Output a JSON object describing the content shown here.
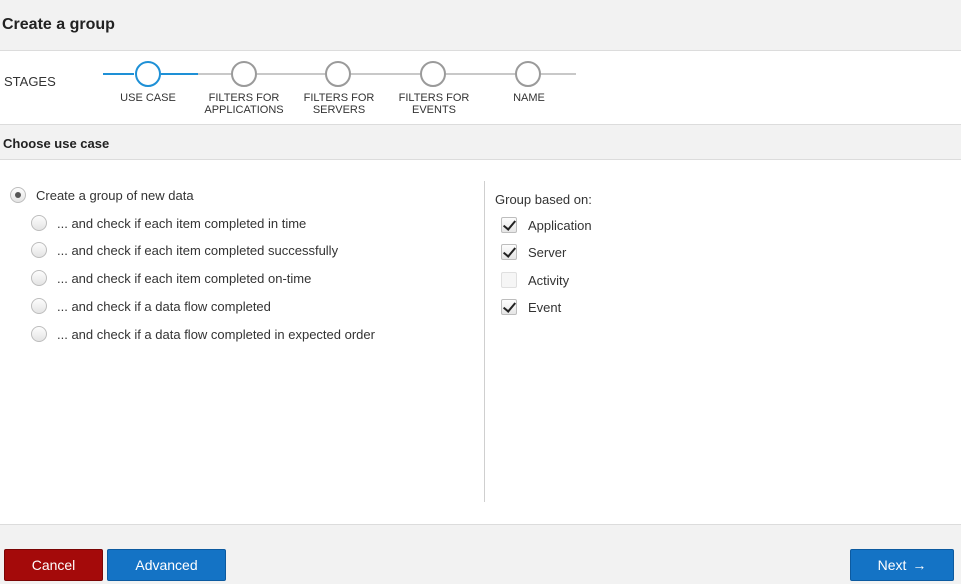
{
  "dialog": {
    "title": "Create a group"
  },
  "stages": {
    "label": "STAGES",
    "steps": [
      {
        "label": "USE CASE",
        "active": true
      },
      {
        "label": "FILTERS FOR\nAPPLICATIONS",
        "active": false
      },
      {
        "label": "FILTERS FOR\nSERVERS",
        "active": false
      },
      {
        "label": "FILTERS FOR\nEVENTS",
        "active": false
      },
      {
        "label": "NAME",
        "active": false
      }
    ]
  },
  "section": {
    "title": "Choose use case"
  },
  "use_cases": {
    "main": {
      "label": "Create a group of new data",
      "checked": true
    },
    "options": [
      {
        "label": "... and check if each item completed in time",
        "checked": false
      },
      {
        "label": "... and check if each item completed successfully",
        "checked": false
      },
      {
        "label": "... and check if each item completed on-time",
        "checked": false
      },
      {
        "label": "... and check if a data flow completed",
        "checked": false
      },
      {
        "label": "... and check if a data flow completed in expected order",
        "checked": false
      }
    ]
  },
  "group_based_on": {
    "label": "Group based on:",
    "items": [
      {
        "label": "Application",
        "checked": true,
        "disabled": false
      },
      {
        "label": "Server",
        "checked": true,
        "disabled": false
      },
      {
        "label": "Activity",
        "checked": false,
        "disabled": true
      },
      {
        "label": "Event",
        "checked": true,
        "disabled": false
      }
    ]
  },
  "footer": {
    "cancel_label": "Cancel",
    "advanced_label": "Advanced",
    "next_label": "Next",
    "next_arrow": "→"
  },
  "colors": {
    "accent": "#1e90d6",
    "primary_button": "#1473c5",
    "cancel_button": "#a40a0a"
  }
}
